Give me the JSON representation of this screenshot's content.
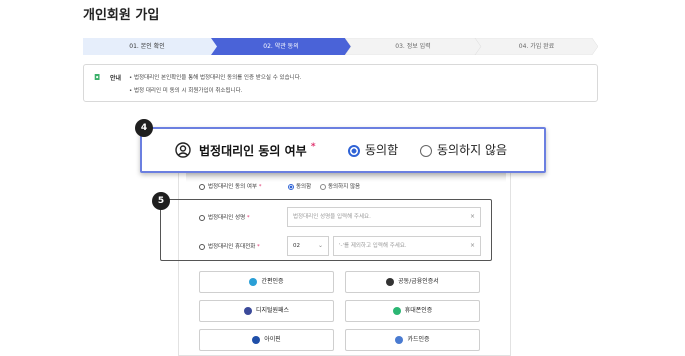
{
  "page_title": "개인회원 가입",
  "steps": [
    {
      "label": "01. 본인 확인",
      "state": "done"
    },
    {
      "label": "02. 약관 동의",
      "state": "active"
    },
    {
      "label": "03. 정보 입력",
      "state": "todo"
    },
    {
      "label": "04. 가입 완료",
      "state": "todo"
    }
  ],
  "notice": {
    "title": "안내",
    "lines": [
      "• 법정대리인 본인확인을 통해 법정대리인 동의를 인증 받으실 수 있습니다.",
      "• 법정 대리인 미 동의 시 회원가입이 취소됩니다."
    ]
  },
  "badges": {
    "zoom": "4",
    "callout": "5"
  },
  "consent": {
    "label": "법정대리인 동의 여부",
    "required_mark": "*",
    "options": [
      "동의함",
      "동의하지 않음"
    ],
    "selected": "동의함"
  },
  "guardian_name": {
    "label": "법정대리인 성명",
    "required_mark": "*",
    "placeholder": "법정대리인 성명을 입력해 주세요.",
    "clear": "×"
  },
  "guardian_phone": {
    "label": "법정대리인 휴대전화",
    "required_mark": "*",
    "prefix": "02",
    "placeholder": "'-'를 제외하고 입력해 주세요.",
    "clear": "×"
  },
  "auth_methods": [
    {
      "label": "간편인증",
      "icon": "simple-auth-icon",
      "color": "#2a9fd6"
    },
    {
      "label": "공동/금융인증서",
      "icon": "certificate-icon",
      "color": "#333333"
    },
    {
      "label": "디지털원패스",
      "icon": "digital-onepass-icon",
      "color": "#3b4a9a"
    },
    {
      "label": "휴대폰인증",
      "icon": "mobile-auth-icon",
      "color": "#2bb673"
    },
    {
      "label": "아이핀",
      "icon": "ipin-icon",
      "color": "#1f4fa8"
    },
    {
      "label": "카드인증",
      "icon": "card-auth-icon",
      "color": "#4a7bd1"
    }
  ],
  "colors": {
    "accent": "#4a63d8",
    "active_step": "#4a63d8",
    "done_step": "#e6eefb",
    "required": "#e0336f"
  }
}
